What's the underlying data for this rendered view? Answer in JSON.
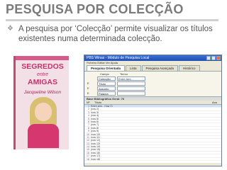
{
  "slide": {
    "title": "PESQUISA POR COLECÇÃO",
    "bullet": "A pesquisa por ‘Colecção’ permite visualizar os títulos existentes numa determinada colecção."
  },
  "cover": {
    "title": "SEGREDOS",
    "subtitle": "entre",
    "title2": "AMIGAS",
    "author": "Jacqueline Wilson"
  },
  "window": {
    "title": "PBS Winas - Módulo de Pesquisa Local",
    "menu": "Ficheiro  Editar  Ver  Ajuda",
    "tabs": [
      "Pesquisa Orientada",
      "Lista",
      "Pesquisa Avançada",
      "Histórico"
    ],
    "header": {
      "field": "Campo",
      "term": "Termo"
    },
    "search_rows": [
      {
        "op": "",
        "field": "Colecção",
        "value": "Entre Ami..."
      },
      {
        "op": "E",
        "field": "Título",
        "value": ""
      },
      {
        "op": "E",
        "field": "Assunto",
        "value": ""
      },
      {
        "op": "E",
        "field": "Palavra",
        "value": ""
      }
    ],
    "result_header": "Base Bibliográfica Geral: 76",
    "columns": [
      "Nº",
      "Título",
      "Ano"
    ],
    "rows": [
      {
        "n": "1",
        "t": "Entre ami... (row 1)",
        "y": ""
      },
      {
        "n": "2",
        "t": "(row 2)",
        "y": ""
      },
      {
        "n": "3",
        "t": "(row 3)",
        "y": ""
      },
      {
        "n": "4",
        "t": "(row 4)",
        "y": ""
      },
      {
        "n": "5",
        "t": "(row 5)",
        "y": ""
      },
      {
        "n": "6",
        "t": "(row 6)",
        "y": ""
      },
      {
        "n": "7",
        "t": "(row 7)",
        "y": ""
      },
      {
        "n": "8",
        "t": "(row 8)",
        "y": ""
      },
      {
        "n": "9",
        "t": "(row 9)",
        "y": ""
      },
      {
        "n": "10",
        "t": "(row 10)",
        "y": ""
      },
      {
        "n": "11",
        "t": "(row 11)",
        "y": ""
      },
      {
        "n": "12",
        "t": "(row 12)",
        "y": ""
      },
      {
        "n": "13",
        "t": "(row 13)",
        "y": ""
      },
      {
        "n": "14",
        "t": "(row 14)",
        "y": ""
      },
      {
        "n": "15",
        "t": "(row 15)",
        "y": ""
      },
      {
        "n": "16",
        "t": "(row 16)",
        "y": ""
      },
      {
        "n": "17",
        "t": "(row 17)",
        "y": ""
      },
      {
        "n": "18",
        "t": "(row 18)",
        "y": ""
      }
    ]
  }
}
